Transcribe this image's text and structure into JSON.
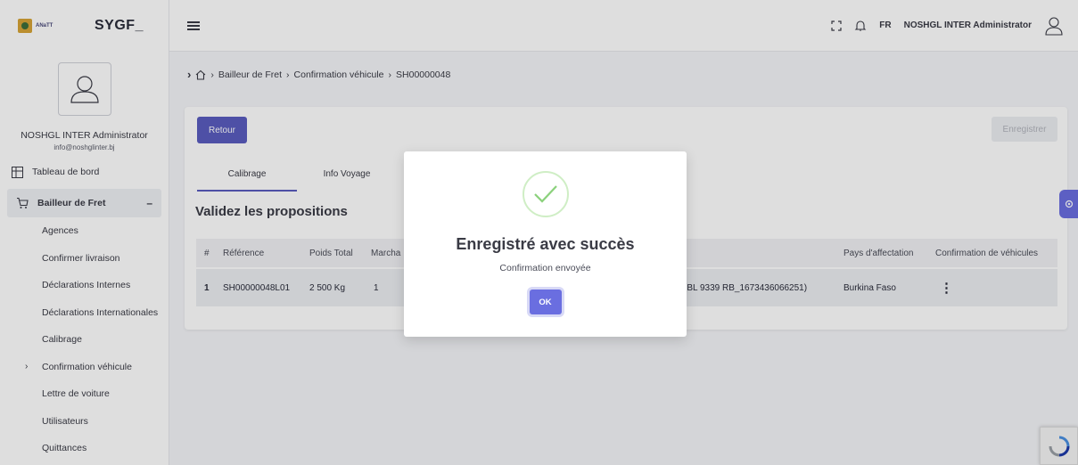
{
  "brand": {
    "logo_text": "ANaTT",
    "name": "SYGF_"
  },
  "user": {
    "name": "NOSHGL INTER Administrator",
    "email": "info@noshglinter.bj"
  },
  "topbar": {
    "lang": "FR",
    "admin_name": "NOSHGL INTER Administrator"
  },
  "sidebar": {
    "dashboard": "Tableau de bord",
    "section": "Bailleur de Fret",
    "section_toggle": "–",
    "items": [
      {
        "label": "Agences"
      },
      {
        "label": "Confirmer livraison"
      },
      {
        "label": "Déclarations Internes"
      },
      {
        "label": "Déclarations Internationales"
      },
      {
        "label": "Calibrage"
      },
      {
        "label": "Confirmation véhicule"
      },
      {
        "label": "Lettre de voiture"
      },
      {
        "label": "Utilisateurs"
      },
      {
        "label": "Quittances"
      }
    ]
  },
  "breadcrumb": {
    "items": [
      "Bailleur de Fret",
      "Confirmation véhicule",
      "SH00000048"
    ]
  },
  "page": {
    "retour": "Retour",
    "enregistrer": "Enregistrer",
    "tabs": [
      {
        "label": "Calibrage"
      },
      {
        "label": "Info Voyage"
      }
    ],
    "section_title": "Validez les propositions"
  },
  "table": {
    "headers": [
      "#",
      "Référence",
      "Poids Total",
      "Marcha",
      "Pays d'affectation",
      "Confirmation de véhicules"
    ],
    "row": {
      "num": "1",
      "reference": "SH00000048L01",
      "poids": "2 500 Kg",
      "marchandise": "1",
      "vehicule": "(BL 9339 RB_1673436066251)",
      "pays": "Burkina Faso",
      "actions": "⋮"
    }
  },
  "modal": {
    "title": "Enregistré avec succès",
    "text": "Confirmation envoyée",
    "ok": "OK"
  },
  "colors": {
    "primary": "#5a5cbf",
    "success": "#8bd17c"
  }
}
